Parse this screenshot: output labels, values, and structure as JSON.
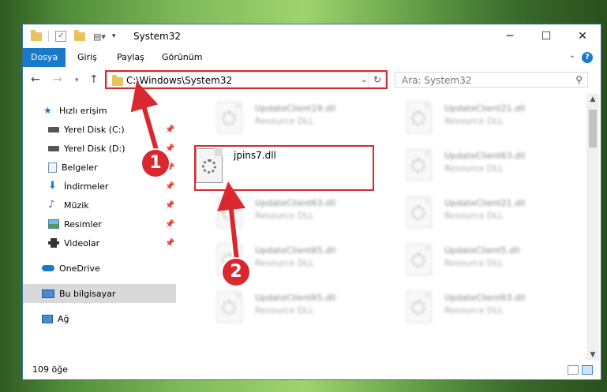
{
  "window": {
    "title": "System32",
    "minimize": "─",
    "maximize": "☐",
    "close": "✕"
  },
  "ribbon": {
    "tabs": [
      {
        "label": "Dosya"
      },
      {
        "label": "Giriş"
      },
      {
        "label": "Paylaş"
      },
      {
        "label": "Görünüm"
      }
    ],
    "help": "?"
  },
  "nav": {
    "back": "←",
    "forward": "→",
    "up": "↑",
    "address": "C:\\Windows\\System32",
    "search_placeholder": "Ara: System32"
  },
  "sidebar": {
    "items": [
      {
        "label": "Hızlı erişim"
      },
      {
        "label": "Yerel Disk (C:)"
      },
      {
        "label": "Yerel Disk (D:)"
      },
      {
        "label": "Belgeler"
      },
      {
        "label": "İndirmeler"
      },
      {
        "label": "Müzik"
      },
      {
        "label": "Resimler"
      },
      {
        "label": "Videolar"
      },
      {
        "label": "OneDrive"
      },
      {
        "label": "Bu bilgisayar"
      },
      {
        "label": "Ağ"
      }
    ]
  },
  "files": {
    "left": [
      {
        "name": "UpdateClient19.dll",
        "type": "Resource DLL"
      },
      {
        "name": "UpdateClient63.dll",
        "type": "Resource DLL"
      },
      {
        "name": "UpdateClient65.dll",
        "type": "Resource DLL"
      },
      {
        "name": "UpdateClient65.dll",
        "type": "Resource DLL"
      }
    ],
    "right": [
      {
        "name": "UpdateClient21.dll",
        "type": "Resource DLL"
      },
      {
        "name": "UpdateClient63.dll",
        "type": "Resource DLL"
      },
      {
        "name": "UpdateClient21.dll",
        "type": "Resource DLL"
      },
      {
        "name": "UpdateClient5.dll",
        "type": "Resource DLL"
      },
      {
        "name": "UpdateClient63.dll",
        "type": "Resource DLL"
      }
    ],
    "selected": {
      "name": "jpins7.dll"
    }
  },
  "annotations": {
    "step1": "1",
    "step2": "2"
  },
  "status": {
    "count": "109 öğe"
  },
  "colors": {
    "accent": "#1979ca",
    "highlight": "#d9282f",
    "selection": "#d9d9d9"
  }
}
